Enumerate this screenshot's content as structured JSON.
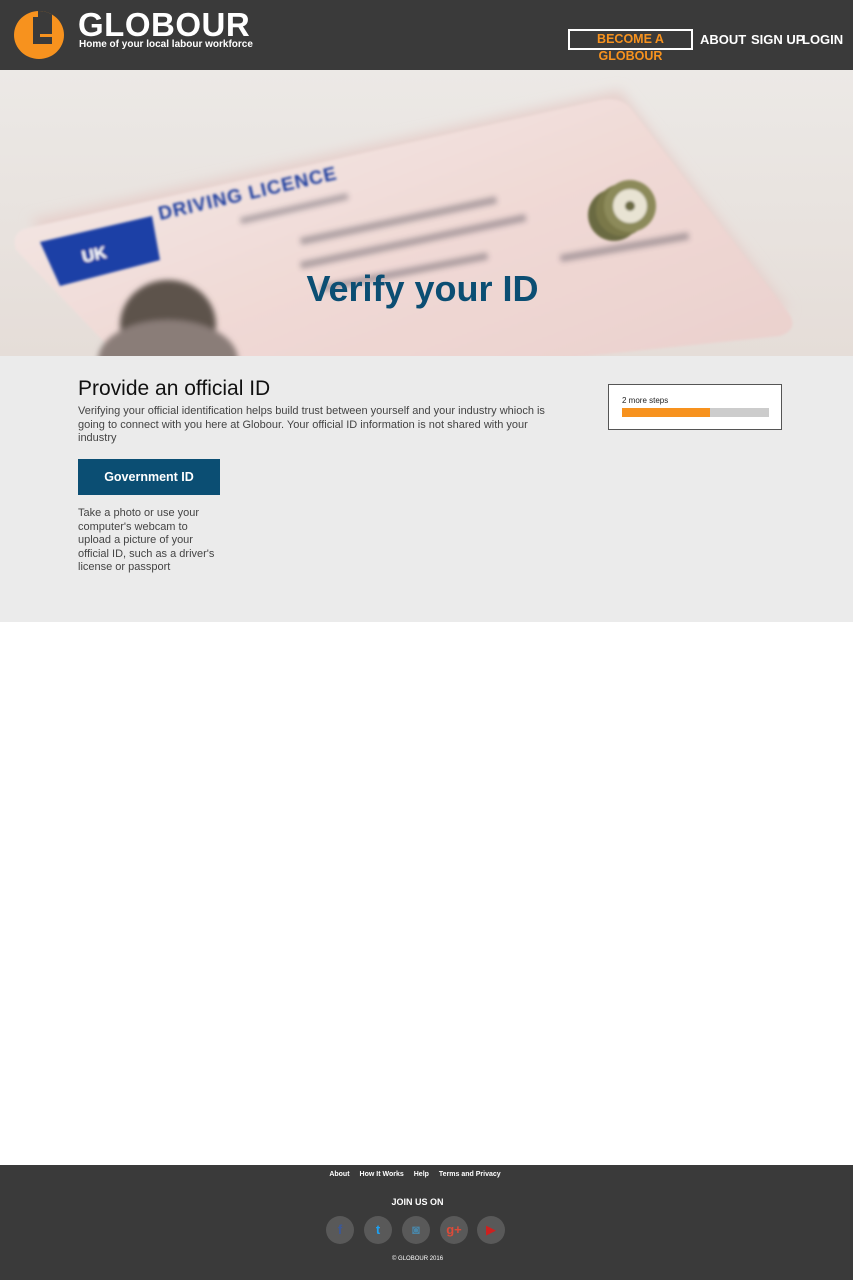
{
  "header": {
    "brand_name": "GLOBOUR",
    "tagline": "Home of your local labour workforce",
    "nav": {
      "become": "BECOME A GLOBOUR",
      "about": "ABOUT",
      "signup": "SIGN UP",
      "login": "LOGIN"
    },
    "colors": {
      "background": "#3a3a3a",
      "accent": "#f7921e"
    }
  },
  "hero": {
    "title": "Verify your ID",
    "card_heading": "DRIVING LICENCE",
    "card_country": "UK",
    "title_color": "#0b4e73"
  },
  "main": {
    "title": "Provide an official ID",
    "description": "Verifying your official identification helps build trust between yourself and your industry whioch is going to connect with you here at Globour. Your official ID information is not shared with your industry",
    "id_button": "Government ID",
    "id_help": "Take a photo or use your computer's webcam to upload a picture of your official ID, such as a driver's license or passport",
    "progress": {
      "label": "2 more steps",
      "fraction": 0.6,
      "fill_color": "#f7921e",
      "track_color": "#cccccc"
    }
  },
  "footer": {
    "links": [
      "About",
      "How It Works",
      "Help",
      "Terms and Privacy"
    ],
    "join_label": "JOIN US ON",
    "social": [
      {
        "icon": "facebook-icon",
        "glyph": "f",
        "color": "#3b5998"
      },
      {
        "icon": "twitter-icon",
        "glyph": "t",
        "color": "#1da1f2"
      },
      {
        "icon": "instagram-icon",
        "glyph": "◙",
        "color": "#4a86a8"
      },
      {
        "icon": "google-plus-icon",
        "glyph": "g+",
        "color": "#dd4b39"
      },
      {
        "icon": "youtube-icon",
        "glyph": "▶",
        "color": "#cd201f"
      }
    ],
    "copyright": "© GLOBOUR 2016"
  }
}
